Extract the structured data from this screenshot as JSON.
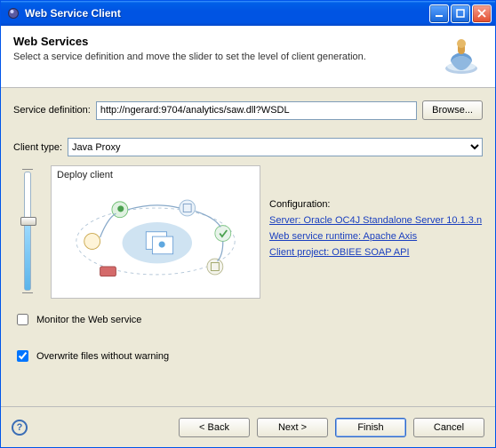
{
  "window": {
    "title": "Web Service Client"
  },
  "banner": {
    "heading": "Web Services",
    "subheading": "Select a service definition and move the slider to set the level of client generation."
  },
  "fields": {
    "service_def_label": "Service definition:",
    "service_def_value": "http://ngerard:9704/analytics/saw.dll?WSDL",
    "browse": "Browse...",
    "client_type_label": "Client type:",
    "client_type_value": "Java Proxy"
  },
  "diagram": {
    "title": "Deploy client"
  },
  "config": {
    "heading": "Configuration:",
    "server_link": "Server: Oracle OC4J Standalone Server 10.1.3.n",
    "runtime_link": "Web service runtime: Apache Axis",
    "project_link": "Client project: OBIEE SOAP API"
  },
  "options": {
    "monitor_label": "Monitor the Web service",
    "monitor_checked": false,
    "overwrite_label": "Overwrite files without warning",
    "overwrite_checked": true
  },
  "buttons": {
    "back": "< Back",
    "next": "Next >",
    "finish": "Finish",
    "cancel": "Cancel",
    "help": "?"
  }
}
